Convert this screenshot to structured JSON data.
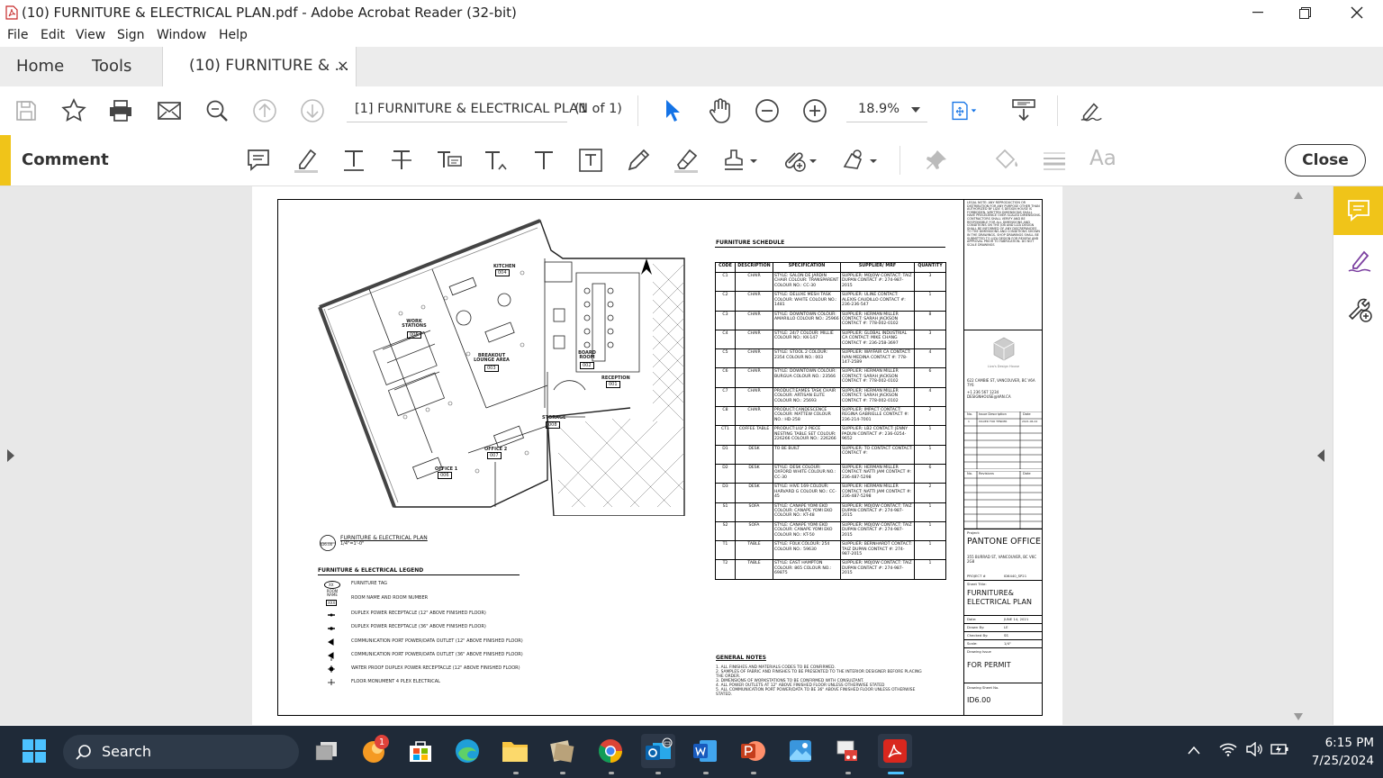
{
  "window": {
    "title": "(10) FURNITURE & ELECTRICAL PLAN.pdf - Adobe Acrobat Reader (32-bit)",
    "minimize": "—",
    "maximize": "❐",
    "close": "✕"
  },
  "menu": [
    "File",
    "Edit",
    "View",
    "Sign",
    "Window",
    "Help"
  ],
  "tabs": {
    "home": "Home",
    "tools": "Tools",
    "doc": "(10) FURNITURE & ...",
    "doc_close": "×"
  },
  "toolbar": {
    "doc_name": "[1] FURNITURE & ELECTRICAL PLAN",
    "page_count": "(1 of 1)",
    "zoom": "18.9%"
  },
  "comment_bar": {
    "label": "Comment",
    "close": "Close",
    "aa": "Aa"
  },
  "drawing": {
    "schedule_title": "FURNITURE SCHEDULE",
    "schedule_headers": [
      "CODE",
      "DESCRIPTION",
      "SPECIFICATION",
      "SUPPLIER/ MRF",
      "QUANTITY"
    ],
    "schedule_rows": [
      [
        "C1",
        "CHAIR",
        "STYLE: SALON DE JARDIN CHAIR COLOUR: TRANSPARENT COLOUR NO.: CC-30",
        "SUPPLIER: MOJOW CONTACT: TAIZ DUPAN CONTACT #: 274-987-2015",
        "3"
      ],
      [
        "C2",
        "CHAIR",
        "STYLE: DELUXE MESH TASK COLOUR: WHITE COLOUR NO.: 1481",
        "SUPPLIER: ULINE CONTACT: ALEXIS CAUDILLO CONTACT #: 236-236-547",
        "1"
      ],
      [
        "C3",
        "CHAIR",
        "STYLE: DOWNTOWN COLOUR: AMARILLO COLOUR NO.: 25966",
        "SUPPLIER: HERMAN MILLER CONTACT: SARAH JACKSON CONTACT #: 778-002-0102",
        "8"
      ],
      [
        "C4",
        "CHAIR",
        "STYLE: 24/7 COLOUR: MILLIE COLOUR NO.: KK-147",
        "SUPPLIER: GLOBAL INDUSTRIAL CA CONTACT: MIKE CHANG CONTACT #: 236-258-3697",
        "3"
      ],
      [
        "C5",
        "CHAIR",
        "STYLE: STOOL 2 COLOUR: 2354 COLOUR NO.: 003",
        "SUPPLIER: WAYFAIR CA CONTACT: IVAN MEDINA CONTACT #: 778-147-2589",
        "4"
      ],
      [
        "C6",
        "CHAIR",
        "STYLE: DOWNTOWN COLOUR: BURGUA COLOUR NO.: 23566",
        "SUPPLIER: HERMAN MILLER CONTACT: SARAH JACKSON CONTACT #: 778-002-0102",
        "6"
      ],
      [
        "C7",
        "CHAIR",
        "PRODUCT:EAMES TASK CHAIR COLOUR: ARTISAN ELITE COLOUR NO.: 25693",
        "SUPPLIER: HERMAN MILLER CONTACT: SARAH JACKSON CONTACT #: 778-002-0102",
        "4"
      ],
      [
        "C8",
        "CHAIR",
        "PRODUCT:CANDESCENCE COLOUR: MATTEW COLOUR NO.: HD-258",
        "SUPPLIER: IMPACT CONTACT: REGINA GABRIELLE CONTACT #: 236-214-7001",
        "2"
      ],
      [
        "CT1",
        "COFFEE TABLE",
        "PRODUCT:LILY 2 PIECE NESTING TABLE SET COLOUR: 226266 COLOUR NO.: 226266",
        "SUPPLIER: LB2 CONTACT: JENNY PADUN CONTACT #: 236-0254-9652",
        "1"
      ],
      [
        "D1",
        "DESK",
        "TO BE BUILT",
        "SUPPLIER: TO CONTACT CONTACT: CONTACT #:",
        "1"
      ],
      [
        "D2",
        "DESK",
        "STYLE: DESK COLOUR: OXFORD WHITE COLOUR NO.: CC-30",
        "SUPPLIER: HERMAN MILLER CONTACT: NATTI JAM CONTACT #: 236-487-5298",
        "6"
      ],
      [
        "D3",
        "DESK",
        "STYLE: HIVE 169 COLOUR: HARVARD G COLOUR NO.: CC-45",
        "SUPPLIER: HERMAN MILLER CONTACT: NATTI JAM CONTACT #: 236-487-5298",
        "2"
      ],
      [
        "S1",
        "SOFA",
        "STYLE: CANAPE YOMI EKO COLOUR: CANAPE YOMI EKO COLOUR NO.: KT-48",
        "SUPPLIER: MOJOW CONTACT: TAIZ DUPAN CONTACT #: 274-987-2015",
        "1"
      ],
      [
        "S2",
        "SOFA",
        "STYLE: CANAPE YOMI EKO COLOUR: CANAPE YOMI EKO COLOUR NO.: KT-50",
        "SUPPLIER: MOJOW CONTACT: TAIZ DUPAN CONTACT #: 274-987-2015",
        "1"
      ],
      [
        "T1",
        "TABLE",
        "STYLE: FOLK COLOUR: 254 COLOUR NO.: 59630",
        "SUPPLIER: BERNHARDT CONTACT: TAIZ DUPAN CONTACT #: 274-987-2015",
        "1"
      ],
      [
        "T2",
        "TABLE",
        "STYLE: EAST HAMPTON COLOUR: 865 COLOUR NO.: 69875",
        "SUPPLIER: MOJOW CONTACT: TAIZ DUPAN CONTACT #: 274-987-2015",
        "1"
      ]
    ],
    "plan_title": "FURNITURE & ELECTRICAL PLAN",
    "plan_scale": "1/4\"=1'-0\"",
    "plan_ref": "ID6.00",
    "rooms": [
      {
        "name": "KITCHEN",
        "num": "004"
      },
      {
        "name": "WORK STATIONS",
        "num": "005"
      },
      {
        "name": "BREAKOUT LOUNGE AREA",
        "num": "003"
      },
      {
        "name": "BOARD ROOM",
        "num": "002"
      },
      {
        "name": "RECEPTION",
        "num": "001"
      },
      {
        "name": "STORAGE",
        "num": "008"
      },
      {
        "name": "OFFICE 2",
        "num": "007"
      },
      {
        "name": "OFFICE 1",
        "num": "006"
      }
    ],
    "legend_title": "FURNITURE & ELECTRICAL LEGEND",
    "legend_items": [
      "FURNITURE TAG",
      "ROOM NAME AND ROOM NUMBER",
      "DUPLEX POWER RECEPTACLE (12\" ABOVE FINISHED FLOOR)",
      "DUPLEX POWER RECEPTACLE (36\" ABOVE FINISHED FLOOR)",
      "COMMUNICATION PORT POWER/DATA OUTLET (12\" ABOVE FINISHED FLOOR)",
      "COMMUNICATION PORT POWER/DATA OUTLET (36\" ABOVE FINISHED FLOOR)",
      "WATER PROOF DUPLEX POWER RECEPTACLE (12\" ABOVE FINISHED FLOOR)",
      "FLOOR MONUMENT 4 PLEX ELECTRICAL"
    ],
    "legend_tag": "XX",
    "legend_room": "ROOM NAME",
    "legend_room_num": "XXX",
    "notes_title": "GENERAL NOTES",
    "notes": [
      "1.   ALL FINISHES AND MATERIALS CODES TO BE CONFIRMED.",
      "2.   SAMPLES OF FABRIC AND FINISHES TO BE PRESENTED TO THE INTERIOR DESIGNER BEFORE PLACING THE ORDER.",
      "3.   DIMENSIONS OF WORKSTATIONS TO BE CONFIRMED WITH CONSULTANT.",
      "4.   ALL POWER OUTLETS AT 12\" ABOVE FINISHED FLOOR UNLESS OTHERWISE STATED",
      "5.   ALL COMMUNICATION PORT POWER/DATA TO BE 36\" ABOVE FINISHED FLOOR UNLESS OTHERWISE STATED."
    ],
    "titleblock": {
      "legal": "LEGAL NOTE: ANY REPRODUCTION OR DISTRIBUTION FOR ANY PURPOSE OTHER THAN AUTHORIZED BY LIZA' S DESIGN HOUSE IS FORBIDDEN. WRITTEN DIMENSIONS SHALL HAVE PRECEDENCE OVER SCALED DIMENSIONS. CONTRACTORS SHALL VERIFY AND BE RESPONSIBLE FOR ALL DIMENSIONS AND CONDITIONS ON THE JOB AND LIZA DESIGN SHALL BE INFORMED OF ANY DISCREPANCIES TO THE DIMENSIONS AND CONDITIONS SHOWN IN THE DRAWINGS. SHOP DRAWINGS SHALL BE SUBMITTED TO LIZA DESIGN FOR REVIEW AND APPROVAL PRIOR TO FABRICATION. DO NOT SCALE DRAWINGS",
      "firm": "Liza's Design House",
      "address": "622 CAMBIE ST, VANCOUVER, BC V6A 7Y6",
      "phone": "+1 236 567 1234",
      "email": "DESIGNHOUSE@VAN.CA",
      "issue_headers": [
        "No.",
        "Issue Description",
        "Date"
      ],
      "issue_row": [
        "1",
        "ISSUED FOR TENDER",
        "2021.06.24"
      ],
      "revision_headers": [
        "No.",
        "Revisions",
        "Date"
      ],
      "project_label": "Project:",
      "project": "PANTONE OFFICE",
      "project_address": "355 BURRAD ST, VANCOUVER, BC V6C 2G8",
      "project_no_label": "PROJECT #",
      "project_no": "ID6440_SP21",
      "sheet_title_label": "Sheet Title:",
      "sheet_title": "FURNITURE& ELECTRICAL PLAN",
      "date_label": "Date:",
      "date": "JUNE 14, 2021",
      "drawn_label": "Drawn By:",
      "drawn": "LE",
      "checked_label": "Checked By:",
      "checked": "SS",
      "scale_label": "Scale:",
      "scale": "1/4\"",
      "issue_label": "Drawing Issue",
      "issue": "FOR  PERMIT",
      "sheet_no_label": "Drawing Sheet No.",
      "sheet_no": "ID6.00"
    }
  },
  "taskbar": {
    "search": "Search",
    "badge": "1",
    "time": "6:15 PM",
    "date": "7/25/2024"
  }
}
